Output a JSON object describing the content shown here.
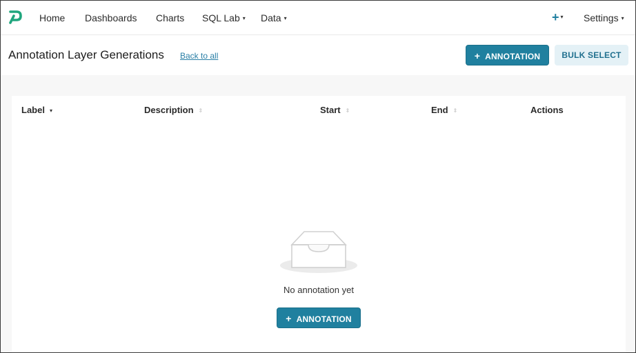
{
  "nav": {
    "items": [
      {
        "label": "Home",
        "has_caret": false
      },
      {
        "label": "Dashboards",
        "has_caret": false
      },
      {
        "label": "Charts",
        "has_caret": false
      },
      {
        "label": "SQL Lab",
        "has_caret": true
      },
      {
        "label": "Data",
        "has_caret": true
      }
    ],
    "plus_label": "+",
    "settings_label": "Settings",
    "caret_glyph": "▾",
    "brand_color": "#20a67e"
  },
  "header": {
    "title": "Annotation Layer Generations",
    "back_link": "Back to all",
    "add_button": "ANNOTATION",
    "bulk_button": "BULK SELECT",
    "plus_glyph": "+"
  },
  "table": {
    "columns": [
      "Label",
      "Description",
      "Start",
      "End",
      "Actions"
    ],
    "sort_active_glyph": "▾",
    "sort_glyph": "⇕"
  },
  "empty": {
    "message": "No annotation yet",
    "button": "ANNOTATION"
  },
  "colors": {
    "primary": "#20809f",
    "secondary_bg": "#e4f1f6",
    "link": "#2a7fa6"
  }
}
